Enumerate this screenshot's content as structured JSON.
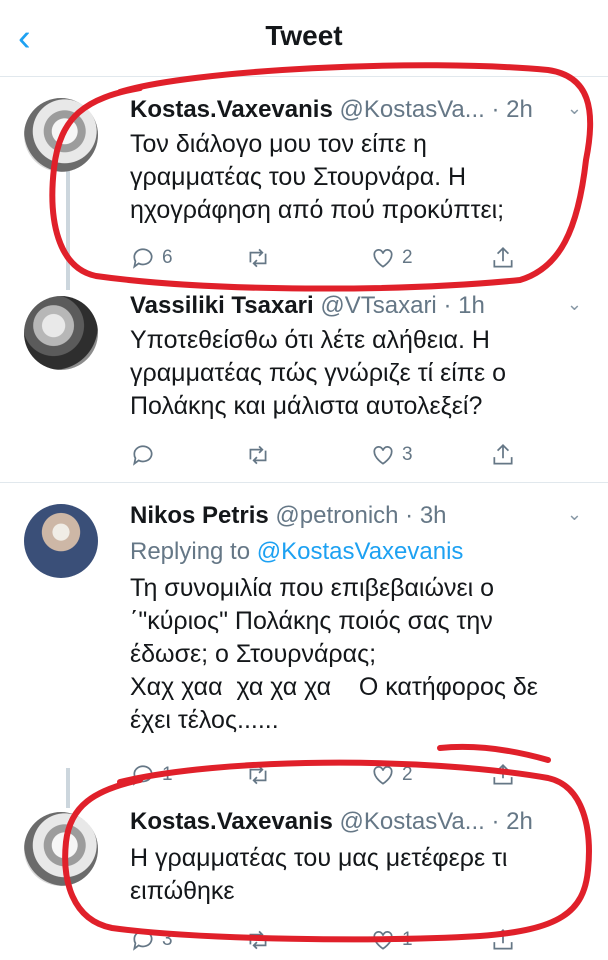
{
  "header": {
    "back_glyph": "‹",
    "title": "Tweet"
  },
  "tweets": [
    {
      "name": "Kostas.Vaxevanis",
      "handle": "@KostasVa...",
      "time": "· 2h",
      "text_lines": [
        "Τον διάλογο μου τον είπε η",
        "γραμματέας του Στουρνάρα. Η",
        "ηχογράφηση από πού προκύπτει;"
      ],
      "replies": "6",
      "retweets": "",
      "likes": "2"
    },
    {
      "name": "Vassiliki Tsaxari",
      "handle": "@VTsaxari",
      "time": "· 1h",
      "text_lines": [
        "Υποτεθείσθω ότι λέτε αλήθεια. Η",
        "γραμματέας πώς γνώριζε τί είπε ο",
        "Πολάκης και μάλιστα αυτολεξεί?"
      ],
      "replies": "",
      "retweets": "",
      "likes": "3"
    },
    {
      "name": "Nikos Petris",
      "handle": "@petronich",
      "time": "· 3h",
      "replying_label": "Replying to",
      "replying_handle": "@KostasVaxevanis",
      "text_lines": [
        "Τη συνομιλία που επιβεβαιώνει ο",
        "΄\"κύριος\" Πολάκης ποιός σας την",
        "έδωσε; ο Στουρνάρας;",
        "Χαχ χαα  χα χα χα    Ο κατήφορος δε",
        "έχει τέλος......"
      ],
      "replies": "1",
      "retweets": "",
      "likes": "2"
    },
    {
      "name": "Kostas.Vaxevanis",
      "handle": "@KostasVa...",
      "time": "· 2h",
      "text_lines": [
        "Η γραμματέας του μας μετέφερε τι",
        "ειπώθηκε"
      ],
      "replies": "3",
      "retweets": "",
      "likes": "1"
    }
  ],
  "icons": [
    "back-icon",
    "reply-icon",
    "retweet-icon",
    "like-icon",
    "share-icon",
    "more-caret-icon"
  ],
  "colors": {
    "accent": "#1da1f2",
    "text": "#14171a",
    "muted": "#657786",
    "annotation": "#e0202a"
  }
}
